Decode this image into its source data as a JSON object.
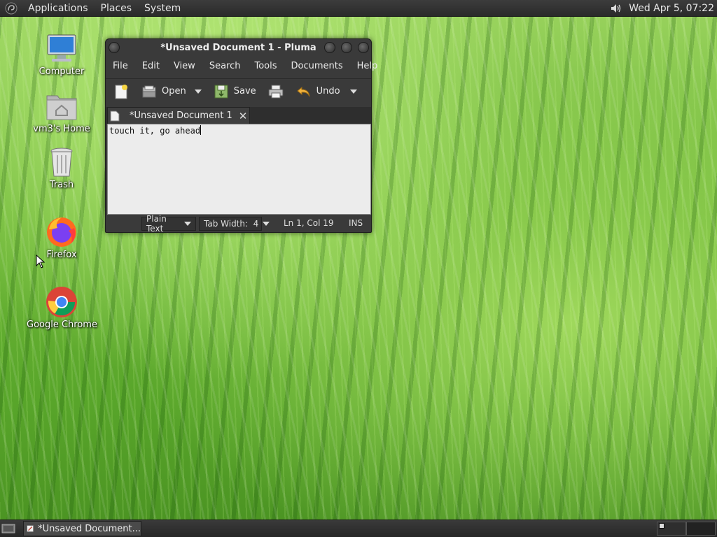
{
  "top_panel": {
    "menus": [
      "Applications",
      "Places",
      "System"
    ],
    "clock": "Wed Apr  5, 07:22",
    "icons": [
      "mate-logo-icon",
      "volume-icon"
    ]
  },
  "desktop_icons": [
    {
      "label": "Computer",
      "icon": "computer-icon"
    },
    {
      "label": "vm3's Home",
      "icon": "home-folder-icon"
    },
    {
      "label": "Trash",
      "icon": "trash-icon"
    },
    {
      "label": "Firefox",
      "icon": "firefox-icon"
    },
    {
      "label": "Google Chrome",
      "icon": "chrome-icon"
    }
  ],
  "window": {
    "title": "*Unsaved Document 1 - Pluma",
    "menus": [
      "File",
      "Edit",
      "View",
      "Search",
      "Tools",
      "Documents",
      "Help"
    ],
    "toolbar": {
      "open": "Open",
      "save": "Save",
      "undo": "Undo"
    },
    "tab_title": "*Unsaved Document 1",
    "content": "touch it, go ahead",
    "status": {
      "language": "Plain Text",
      "tab_width": "Tab Width:  4",
      "position": "Ln 1, Col 19",
      "mode": "INS"
    }
  },
  "bottom_panel": {
    "task_label": "*Unsaved Document..."
  },
  "colors": {
    "panel": "#2a2a2a",
    "window": "#3a3a3a",
    "editor_bg": "#ececec",
    "grass": "#6fb838"
  }
}
